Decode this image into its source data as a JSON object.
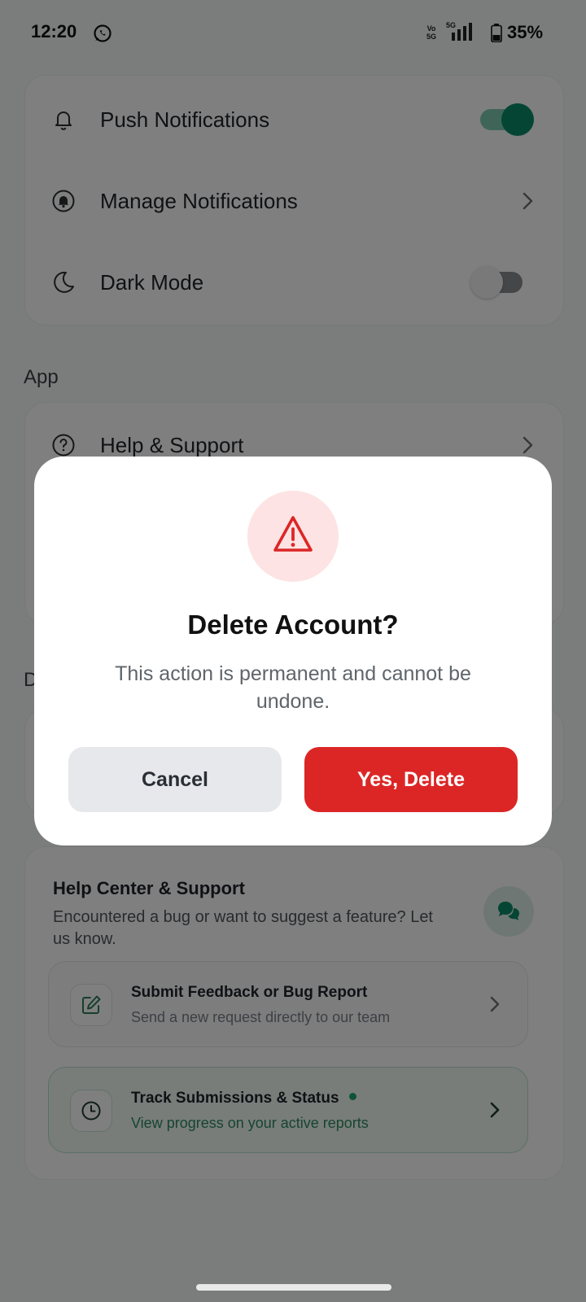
{
  "status_bar": {
    "time": "12:20",
    "network_volte": "Vo\n5G",
    "network_5g": "5G",
    "battery": "35%"
  },
  "settings_card": {
    "items": [
      {
        "label": "Push Notifications",
        "icon": "bell-icon",
        "control": "toggle",
        "state": "on"
      },
      {
        "label": "Manage Notifications",
        "icon": "bell-circle-icon",
        "control": "chevron"
      },
      {
        "label": "Dark Mode",
        "icon": "moon-icon",
        "control": "toggle",
        "state": "off"
      }
    ]
  },
  "app_section": {
    "title": "App",
    "items": [
      {
        "label": "Help & Support",
        "icon": "help-circle-icon",
        "control": "chevron"
      }
    ]
  },
  "partial_section_letter": "D",
  "help_center": {
    "title": "Help Center & Support",
    "description": "Encountered a bug or want to suggest a feature? Let us know.",
    "chat_icon": "chat-bubbles-icon",
    "feedback": {
      "title": "Submit Feedback or Bug Report",
      "subtitle": "Send a new request directly to our team",
      "icon": "edit-square-icon"
    },
    "track": {
      "title": "Track Submissions & Status",
      "subtitle": "View progress on your active reports",
      "icon": "clock-icon"
    }
  },
  "dialog": {
    "icon": "warning-triangle-icon",
    "title": "Delete Account?",
    "message": "This action is permanent and cannot be undone.",
    "cancel_label": "Cancel",
    "confirm_label": "Yes, Delete"
  },
  "colors": {
    "accent_green": "#0b8a67",
    "danger_red": "#dc2626",
    "danger_tint": "#fde3e3",
    "overlay": "rgba(0,0,0,0.5)"
  }
}
